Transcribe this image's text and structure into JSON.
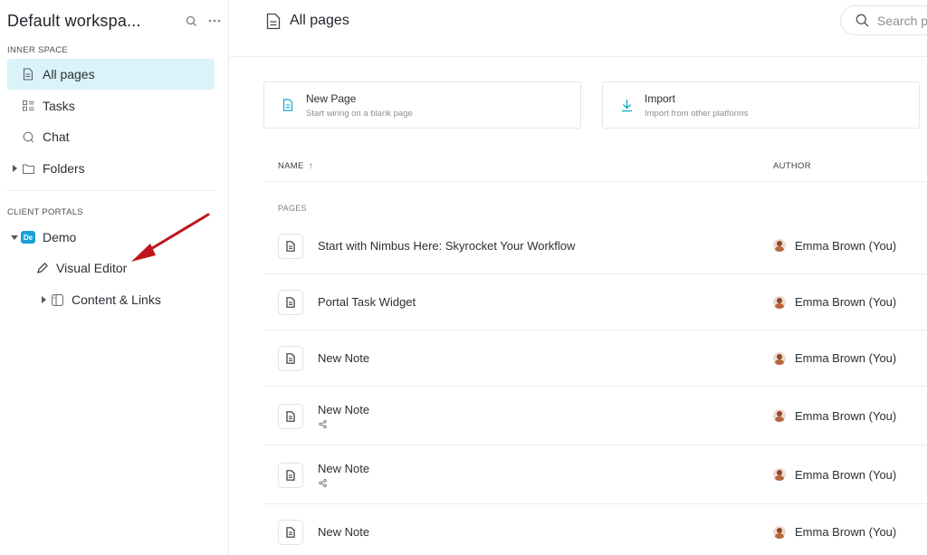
{
  "sidebar": {
    "workspace_title": "Default workspa...",
    "inner_space_label": "INNER SPACE",
    "items": [
      {
        "label": "All pages",
        "icon": "document-icon"
      },
      {
        "label": "Tasks",
        "icon": "tasks-icon"
      },
      {
        "label": "Chat",
        "icon": "chat-icon"
      },
      {
        "label": "Folders",
        "icon": "folder-icon"
      }
    ],
    "client_portals_label": "CLIENT PORTALS",
    "portal": {
      "badge": "De",
      "label": "Demo"
    },
    "portal_items": [
      {
        "label": "Visual Editor",
        "icon": "pencil-icon"
      },
      {
        "label": "Content & Links",
        "icon": "layout-icon"
      }
    ]
  },
  "header": {
    "title": "All pages",
    "search_placeholder": "Search p"
  },
  "actions": [
    {
      "title": "New Page",
      "subtitle": "Start wiring on a blank page",
      "icon": "new-page-icon"
    },
    {
      "title": "Import",
      "subtitle": "Import from other platforms",
      "icon": "download-icon"
    }
  ],
  "table": {
    "columns": {
      "name": "NAME",
      "sort_arrow": "↑",
      "author": "AUTHOR"
    },
    "group_label": "PAGES",
    "rows": [
      {
        "name": "Start with Nimbus Here: Skyrocket Your Workflow",
        "author": "Emma Brown (You)",
        "shared": false
      },
      {
        "name": "Portal Task Widget",
        "author": "Emma Brown (You)",
        "shared": false
      },
      {
        "name": "New Note",
        "author": "Emma Brown (You)",
        "shared": false
      },
      {
        "name": "New Note",
        "author": "Emma Brown (You)",
        "shared": true
      },
      {
        "name": "New Note",
        "author": "Emma Brown (You)",
        "shared": true
      },
      {
        "name": "New Note",
        "author": "Emma Brown (You)",
        "shared": false
      }
    ]
  },
  "colors": {
    "accent": "#16a8c9",
    "active_bg": "#d9f3f9",
    "portal_badge": "#1a9fd8",
    "annotation_arrow": "#c0141b"
  }
}
